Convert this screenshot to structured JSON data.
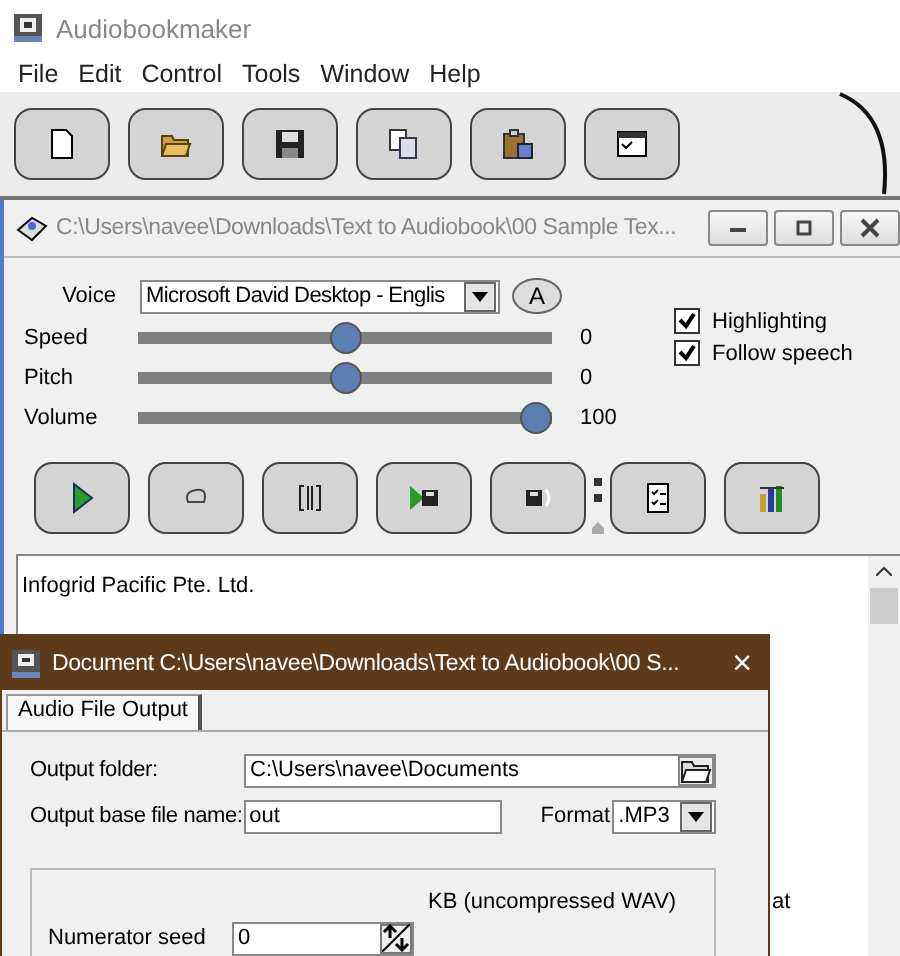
{
  "app": {
    "title": "Audiobookmaker"
  },
  "menu": [
    "File",
    "Edit",
    "Control",
    "Tools",
    "Window",
    "Help"
  ],
  "document_window": {
    "title": "C:\\Users\\navee\\Downloads\\Text to Audiobook\\00 Sample Tex...",
    "voice": {
      "label": "Voice",
      "value": "Microsoft David Desktop - Englis",
      "button": "A"
    },
    "checkboxes": [
      {
        "label": "Highlighting",
        "checked": true
      },
      {
        "label": "Follow speech",
        "checked": true
      }
    ],
    "sliders": [
      {
        "label": "Speed",
        "level": 0.5,
        "reading": "0"
      },
      {
        "label": "Pitch",
        "level": 0.5,
        "reading": "0"
      },
      {
        "label": "Volume",
        "level": 1,
        "reading": "100"
      }
    ],
    "text_lines": [
      "Infogrid Pacific Pte. Ltd.",
      "at"
    ]
  },
  "dialog": {
    "title": "Document C:\\Users\\navee\\Downloads\\Text to Audiobook\\00 S...",
    "close": "×",
    "tabs": [
      {
        "label": "Audio File Output",
        "selected": true
      }
    ],
    "output_folder": {
      "label": "Output folder:",
      "value": "C:\\Users\\navee\\Documents"
    },
    "base_name": {
      "label": "Output base file name:",
      "value": "out"
    },
    "format": {
      "label": "Format",
      "value": ".MP3"
    },
    "size_note": "KB (uncompressed WAV)",
    "numerator_seed": {
      "label": "Numerator seed",
      "value": "0"
    }
  }
}
